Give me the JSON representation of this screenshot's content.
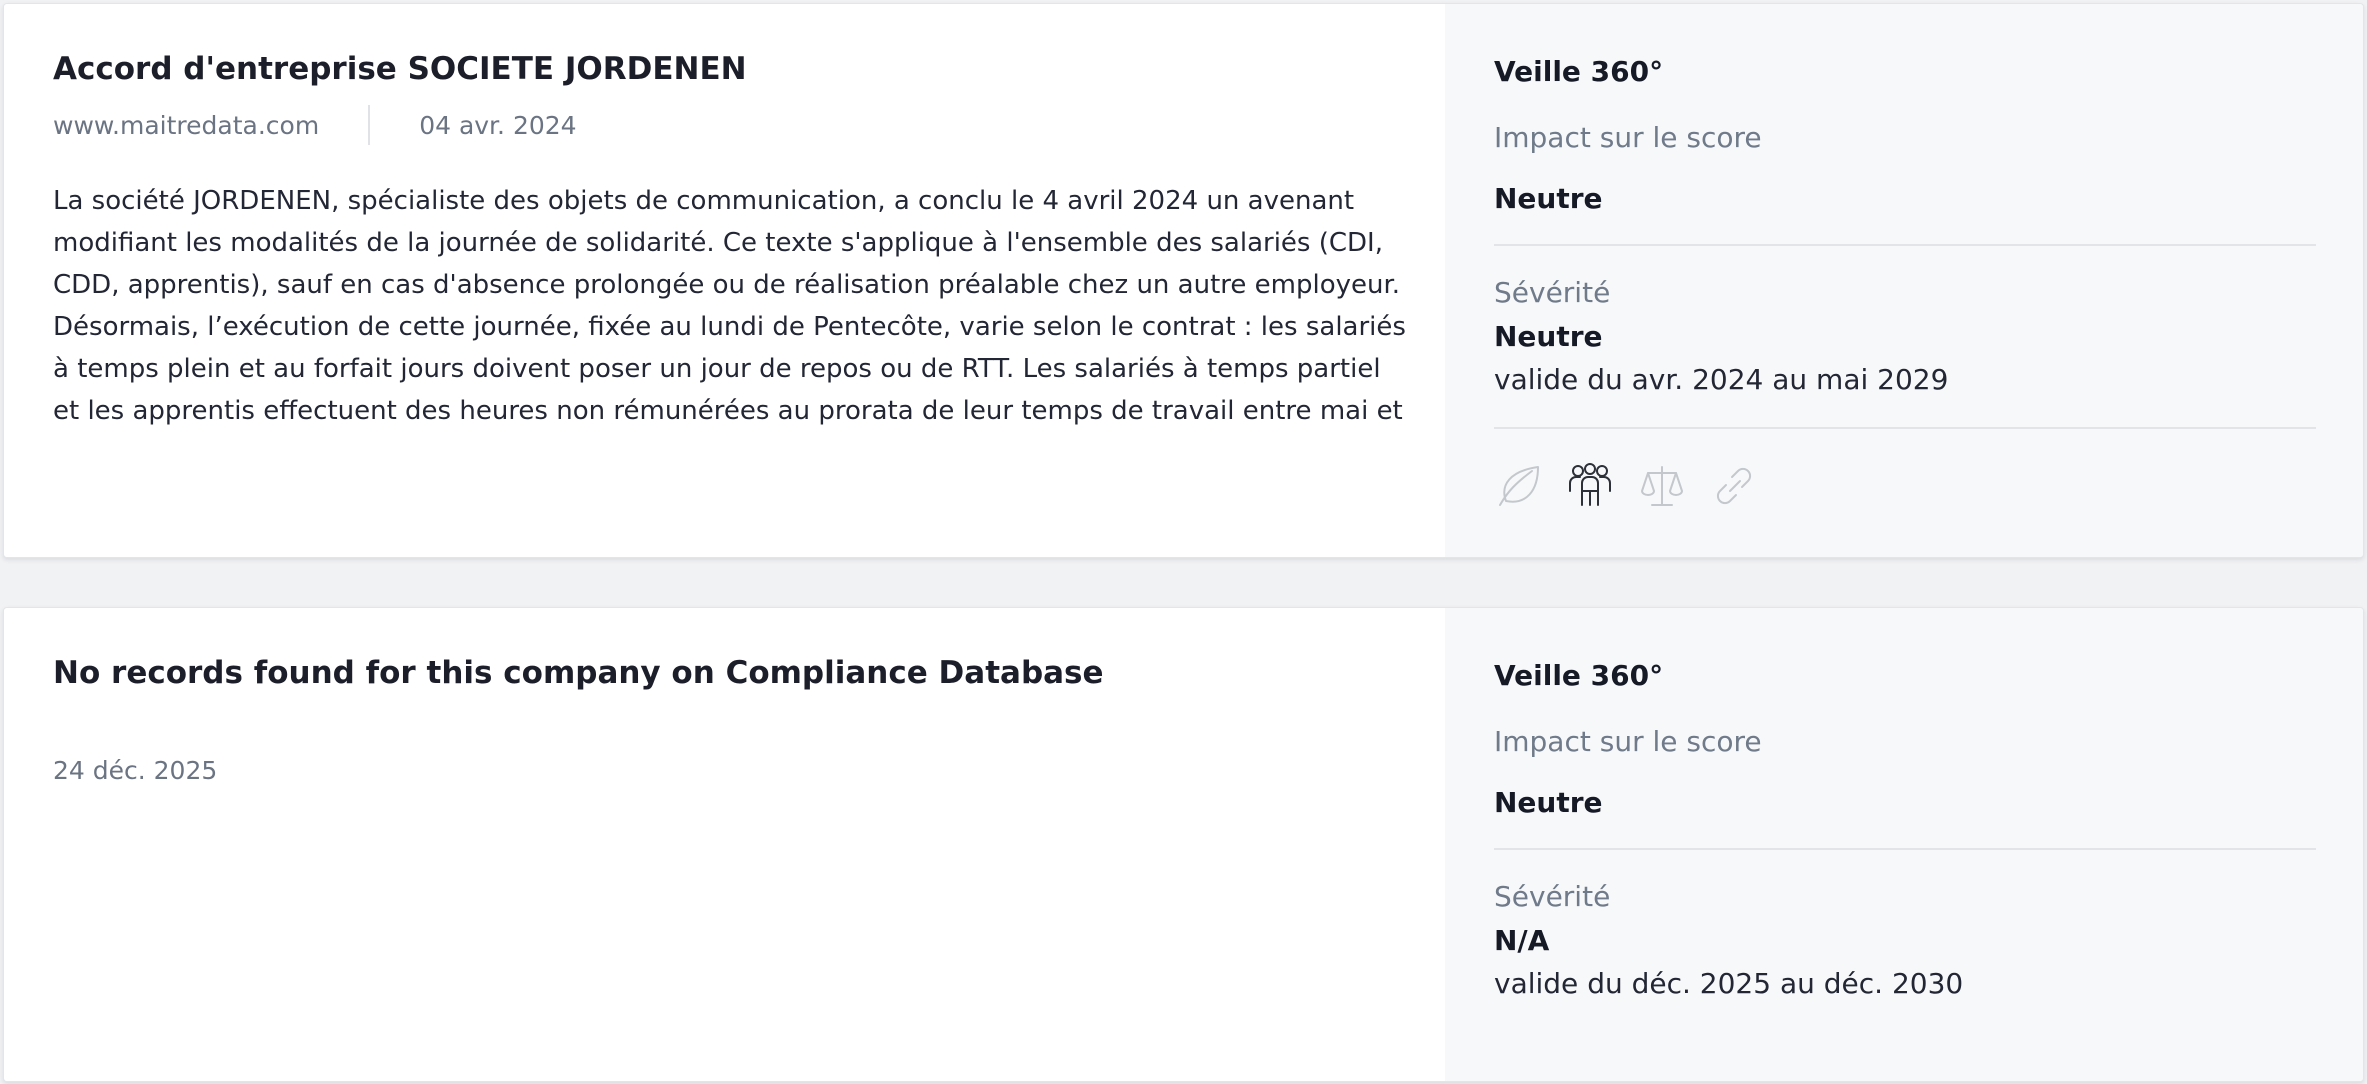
{
  "cards": [
    {
      "title": "Accord d'entreprise SOCIETE JORDENEN",
      "source": "www.maitredata.com",
      "date": "04 avr. 2024",
      "description": "La société JORDENEN, spécialiste des objets de communication, a conclu le 4 avril 2024 un avenant modifiant les modalités de la journée de solidarité. Ce texte s'applique à l'ensemble des salariés (CDI, CDD, apprentis), sauf en cas d'absence prolongée ou de réalisation préalable chez un autre employeur. Désormais, l’exécution de cette journée, fixée au lundi de Pentecôte, varie selon le contrat : les salariés à temps plein et au forfait jours doivent poser un jour de repos ou de RTT. Les salariés à temps partiel et les apprentis effectuent des heures non rémunérées au prorata de leur temps de travail entre mai et",
      "veille_label": "Veille 360°",
      "impact_label": "Impact sur le score",
      "impact_value": "Neutre",
      "severity_label": "Sévérité",
      "severity_value": "Neutre",
      "validity": "valide du avr. 2024 au mai 2029",
      "icons": [
        "leaf-icon",
        "people-icon",
        "scale-icon",
        "link-icon"
      ]
    },
    {
      "title": "No records found for this company on Compliance Database",
      "date": "24 déc. 2025",
      "veille_label": "Veille 360°",
      "impact_label": "Impact sur le score",
      "impact_value": "Neutre",
      "severity_label": "Sévérité",
      "severity_value": "N/A",
      "validity": "valide du déc. 2025 au déc. 2030"
    }
  ],
  "colors": {
    "page_bg": "#f1f2f4",
    "card_bg": "#ffffff",
    "side_bg": "#f7f8f9",
    "muted_text": "#6b7483",
    "icon_inactive": "#c4c8cd",
    "icon_active": "#2d3039"
  }
}
